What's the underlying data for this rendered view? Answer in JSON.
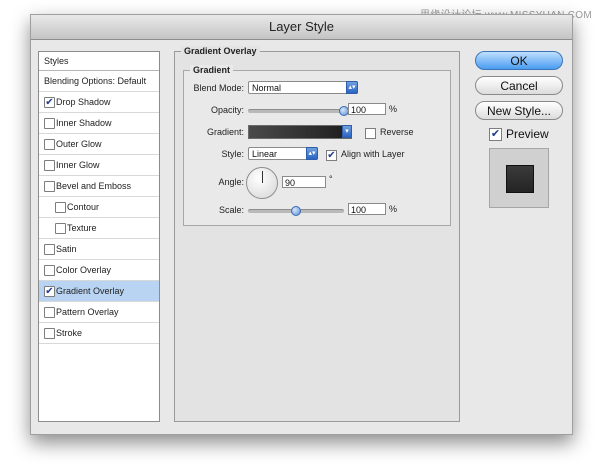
{
  "watermark": "思缘设计论坛 www.MISSYUAN.COM",
  "dialog": {
    "title": "Layer Style"
  },
  "styles_panel": {
    "header": "Styles",
    "items": [
      {
        "label": "Blending Options: Default",
        "checkbox": false,
        "checked": false,
        "indent": false,
        "selected": false
      },
      {
        "label": "Drop Shadow",
        "checkbox": true,
        "checked": true,
        "indent": false,
        "selected": false
      },
      {
        "label": "Inner Shadow",
        "checkbox": true,
        "checked": false,
        "indent": false,
        "selected": false
      },
      {
        "label": "Outer Glow",
        "checkbox": true,
        "checked": false,
        "indent": false,
        "selected": false
      },
      {
        "label": "Inner Glow",
        "checkbox": true,
        "checked": false,
        "indent": false,
        "selected": false
      },
      {
        "label": "Bevel and Emboss",
        "checkbox": true,
        "checked": false,
        "indent": false,
        "selected": false
      },
      {
        "label": "Contour",
        "checkbox": true,
        "checked": false,
        "indent": true,
        "selected": false
      },
      {
        "label": "Texture",
        "checkbox": true,
        "checked": false,
        "indent": true,
        "selected": false
      },
      {
        "label": "Satin",
        "checkbox": true,
        "checked": false,
        "indent": false,
        "selected": false
      },
      {
        "label": "Color Overlay",
        "checkbox": true,
        "checked": false,
        "indent": false,
        "selected": false
      },
      {
        "label": "Gradient Overlay",
        "checkbox": true,
        "checked": true,
        "indent": false,
        "selected": true
      },
      {
        "label": "Pattern Overlay",
        "checkbox": true,
        "checked": false,
        "indent": false,
        "selected": false
      },
      {
        "label": "Stroke",
        "checkbox": true,
        "checked": false,
        "indent": false,
        "selected": false
      }
    ]
  },
  "gradient_overlay": {
    "group_title": "Gradient Overlay",
    "sub_title": "Gradient",
    "blend_mode_label": "Blend Mode:",
    "blend_mode_value": "Normal",
    "opacity_label": "Opacity:",
    "opacity_value": "100",
    "opacity_unit": "%",
    "opacity_level": 1.0,
    "gradient_label": "Gradient:",
    "reverse_label": "Reverse",
    "reverse_checked": false,
    "style_label": "Style:",
    "style_value": "Linear",
    "align_label": "Align with Layer",
    "align_checked": true,
    "angle_label": "Angle:",
    "angle_value": "90",
    "angle_unit": "°",
    "scale_label": "Scale:",
    "scale_value": "100",
    "scale_unit": "%",
    "scale_level": 0.5
  },
  "buttons": {
    "ok": "OK",
    "cancel": "Cancel",
    "new_style": "New Style..."
  },
  "preview": {
    "label": "Preview",
    "checked": true
  },
  "colors": {
    "accent": "#4a9cf0",
    "selection": "#b9d4f2",
    "gradient_start": "#4a4a4a",
    "gradient_end": "#1d1d1d"
  },
  "icons": {
    "check": "checkmark-icon",
    "dropdown": "up-down-arrows-icon"
  }
}
